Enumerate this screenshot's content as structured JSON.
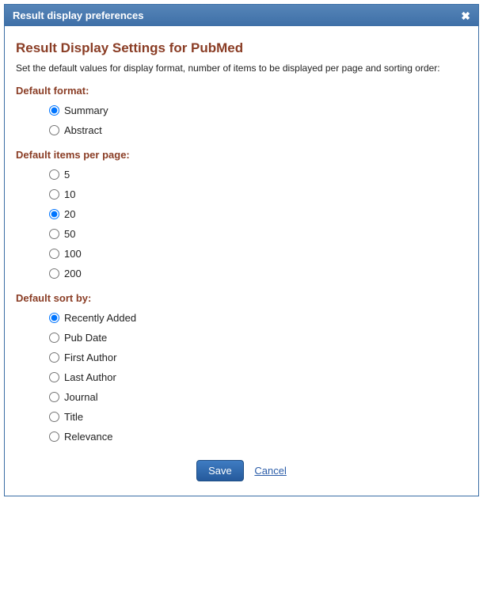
{
  "titlebar": {
    "title": "Result display preferences"
  },
  "heading": "Result Display Settings for PubMed",
  "description": "Set the default values for display format, number of items to be displayed per page and sorting order:",
  "sections": {
    "format": {
      "label": "Default format:",
      "options": [
        "Summary",
        "Abstract"
      ],
      "selected": "Summary"
    },
    "items": {
      "label": "Default items per page:",
      "options": [
        "5",
        "10",
        "20",
        "50",
        "100",
        "200"
      ],
      "selected": "20"
    },
    "sort": {
      "label": "Default sort by:",
      "options": [
        "Recently Added",
        "Pub Date",
        "First Author",
        "Last Author",
        "Journal",
        "Title",
        "Relevance"
      ],
      "selected": "Recently Added"
    }
  },
  "actions": {
    "save": "Save",
    "cancel": "Cancel"
  }
}
